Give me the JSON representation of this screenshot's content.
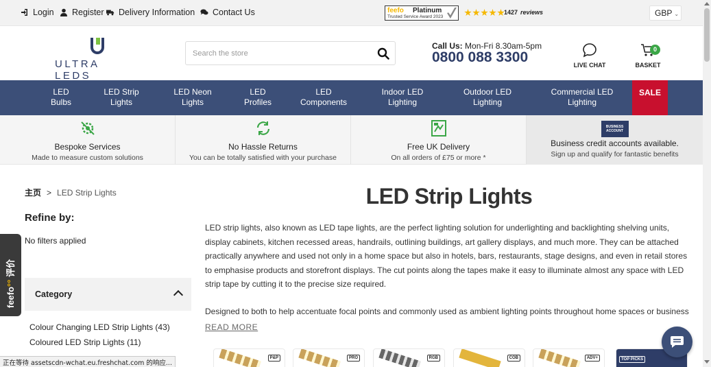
{
  "topbar": {
    "login": "Login",
    "register": "Register",
    "delivery": "Delivery Information",
    "contact": "Contact Us",
    "feefo_brand": "feefo",
    "feefo_platinum": "Platinum",
    "feefo_award": "Trusted Service Award 2023",
    "review_count": "1427",
    "reviews_label": "reviews",
    "currency": "GBP",
    "star_color": "#f5b800"
  },
  "header": {
    "logo_text": "ULTRA LEDS",
    "search_placeholder": "Search the store",
    "call_label": "Call Us:",
    "call_hours": "Mon-Fri 8.30am-5pm",
    "phone": "0800 088 3300",
    "live_chat": "LIVE CHAT",
    "basket": "BASKET",
    "basket_count": "0",
    "brand_color": "#2e3d67",
    "accent_color": "#7ec242"
  },
  "nav": {
    "items": [
      {
        "line1": "LED",
        "line2": "Bulbs"
      },
      {
        "line1": "LED Strip",
        "line2": "Lights"
      },
      {
        "line1": "LED Neon",
        "line2": "Lights"
      },
      {
        "line1": "LED",
        "line2": "Profiles"
      },
      {
        "line1": "LED",
        "line2": "Components"
      },
      {
        "line1": "Indoor LED",
        "line2": "Lighting"
      },
      {
        "line1": "Outdoor LED",
        "line2": "Lighting"
      },
      {
        "line1": "Commercial LED",
        "line2": "Lighting"
      }
    ],
    "sale": "SALE",
    "bg_color": "#3c4f78",
    "sale_color": "#c8102e"
  },
  "usp": [
    {
      "title": "Bespoke Services",
      "subtitle": "Made to measure custom solutions",
      "icon": "gear-icon"
    },
    {
      "title": "No Hassle Returns",
      "subtitle": "You can be totally satisfied with your purchase",
      "icon": "refresh-icon"
    },
    {
      "title": "Free UK Delivery",
      "subtitle": "On all orders of £75 or more *",
      "icon": "delivery-map-icon"
    },
    {
      "title": "Business credit accounts available.",
      "subtitle": "Sign up and qualify for fantastic benefits",
      "icon": "business-account-icon",
      "icon_text": "BUSINESS ACCOUNT"
    }
  ],
  "breadcrumb": {
    "home": "主页",
    "separator": ">",
    "current": "LED Strip Lights"
  },
  "sidebar": {
    "refine": "Refine by:",
    "no_filters": "No filters applied",
    "category_title": "Category",
    "categories": [
      "Colour Changing LED Strip Lights (43)",
      "Coloured LED Strip Lights (11)"
    ]
  },
  "main": {
    "title": "LED Strip Lights",
    "paragraph1": "LED strip lights, also known as LED tape lights, are the perfect lighting solution for underlighting and backlighting shelving units, display cabinets, kitchen recessed areas, handrails, outlining buildings, art gallery displays, and much more. They can be attached practically anywhere and used not only in a home space but also in hotels, bars, restaurants, stage designs, and even in retail stores to emphasise products and storefront displays. The cut points along the tapes make it easy to illuminate almost any space with LED strip tape by cutting it to the precise size required.",
    "paragraph2": "Designed to both to help accentuate focal points and commonly used as ambient lighting points throughout home spaces or business",
    "read_more": "READ MORE"
  },
  "product_tags": [
    "P&P",
    "PRO",
    "RGB",
    "COB",
    "ADV+",
    "TOP PICKS"
  ],
  "feefo_tab": {
    "brand": "feefo",
    "label": "评价"
  },
  "status_bar": "正在等待 assetscdn-wchat.eu.freshchat.com 的响应..."
}
